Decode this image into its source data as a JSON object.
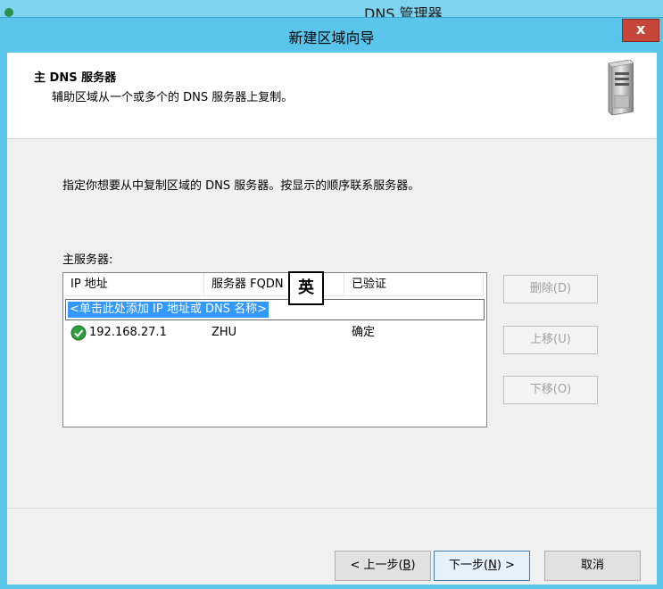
{
  "background_window": {
    "title": "DNS 管理器"
  },
  "dialog": {
    "title": "新建区域向导",
    "close_label": "x"
  },
  "header": {
    "title": "主 DNS 服务器",
    "subtitle": "辅助区域从一个或多个的 DNS 服务器上复制。",
    "icon": "server-icon"
  },
  "body": {
    "instruction": "指定你想要从中复制区域的 DNS 服务器。按显示的顺序联系服务器。",
    "list_label": "主服务器:"
  },
  "listview": {
    "columns": [
      "IP 地址",
      "服务器 FQDN",
      "已验证"
    ],
    "add_prompt": "<单击此处添加 IP 地址或 DNS 名称>",
    "rows": [
      {
        "ip": "192.168.27.1",
        "fqdn": "ZHU",
        "verified": "确定",
        "status_icon": "check-icon"
      }
    ]
  },
  "side_buttons": {
    "delete": "删除(D)",
    "move_up": "上移(U)",
    "move_down": "下移(O)"
  },
  "ime_indicator": "英",
  "footer": {
    "back_pre": "< 上一步(",
    "back_key": "B",
    "back_post": ")",
    "next_pre": "下一步(",
    "next_key": "N",
    "next_post": ") >",
    "cancel": "取消"
  },
  "colors": {
    "title_bar": "#59c5ea",
    "selection": "#3399ff",
    "close_button": "#c7463a",
    "check_green": "#2e9e3e"
  }
}
